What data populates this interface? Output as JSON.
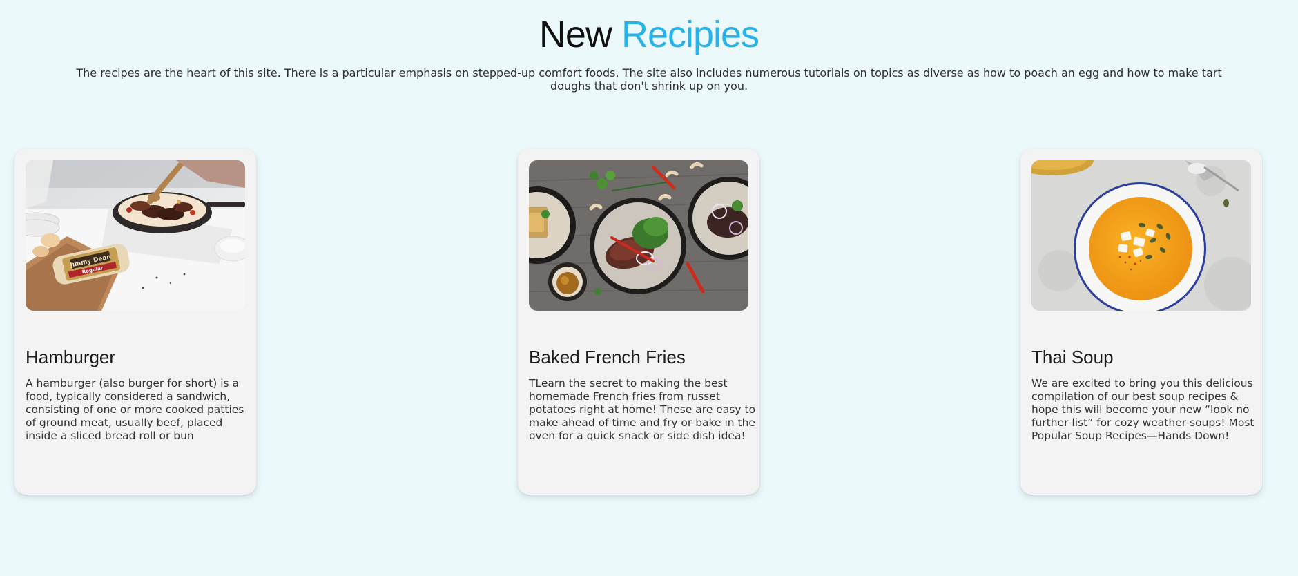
{
  "section": {
    "title_part1": "New",
    "title_part2": "Recipies",
    "intro": "The recipes are the heart of this site. There is a particular emphasis on stepped-up comfort foods. The site also includes numerous tutorials on topics as diverse as how to poach an egg and how to make tart doughs that don't shrink up on you."
  },
  "colors": {
    "background": "#ecf9fb",
    "accent": "#27b3e8",
    "card": "#f3f3f3"
  },
  "cards": [
    {
      "title": "Hamburger",
      "description": "A hamburger (also burger for short) is a food, typically considered a sandwich, consisting of one or more cooked patties of ground meat, usually beef, placed inside a sliced bread roll or bun",
      "image": "hamburger-photo",
      "package_label": "Jimmy Dean",
      "package_sublabel": "Regular"
    },
    {
      "title": "Baked French Fries",
      "description": "TLearn the secret to making the best homemade French fries from russet potatoes right at home! These are easy to make ahead of time and fry or bake in the oven for a quick snack or side dish idea!",
      "image": "baked-french-fries-photo"
    },
    {
      "title": "Thai Soup",
      "description": "We are excited to bring you this delicious compilation of our best soup recipes & hope this will become your new “look no further list” for cozy weather soups! Most Popular Soup Recipes—Hands Down!",
      "image": "thai-soup-photo"
    }
  ]
}
